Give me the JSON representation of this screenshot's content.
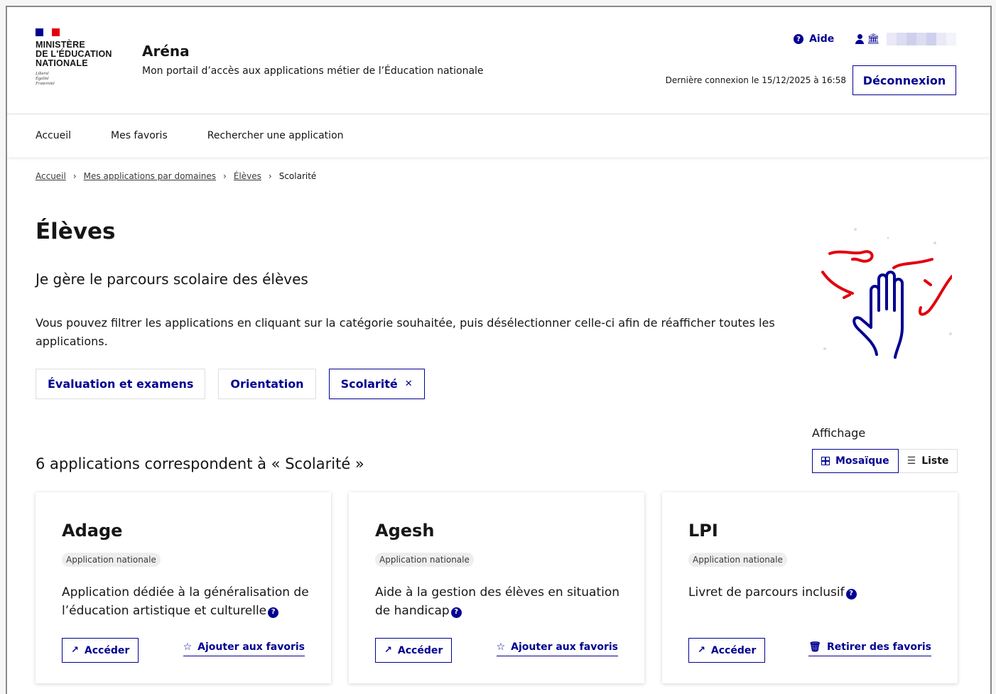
{
  "header": {
    "ministry_lines": [
      "MINISTÈRE",
      "DE L'ÉDUCATION",
      "NATIONALE"
    ],
    "motto_lines": [
      "Liberté",
      "Égalité",
      "Fraternité"
    ],
    "app_name": "Aréna",
    "tagline": "Mon portail d’accès aux applications métier de l’Éducation nationale",
    "help_label": "Aide",
    "help_icon": "question-circle-icon",
    "account_icons": [
      "user-icon",
      "institution-icon"
    ],
    "last_login": "Dernière connexion le 15/12/2025 à 16:58",
    "logout_label": "Déconnexion",
    "colors": {
      "primary": "#000091",
      "flag_red": "#e1000f"
    }
  },
  "nav": {
    "items": [
      "Accueil",
      "Mes favoris",
      "Rechercher une application"
    ]
  },
  "breadcrumb": {
    "links": [
      "Accueil",
      "Mes applications par domaines",
      "Élèves"
    ],
    "current": "Scolarité"
  },
  "page": {
    "title": "Élèves",
    "subtitle": "Je gère le parcours scolaire des élèves",
    "intro": "Vous pouvez filtrer les applications en cliquant sur la catégorie souhaitée, puis désélectionner celle-ci afin de réafficher toutes les applications.",
    "filters": [
      {
        "label": "Évaluation et examens",
        "selected": false
      },
      {
        "label": "Orientation",
        "selected": false
      },
      {
        "label": "Scolarité",
        "selected": true
      }
    ],
    "remove_filter_icon": "close-icon",
    "results_text": "6 applications correspondent à « Scolarité »",
    "display_label": "Affichage",
    "display_options": [
      {
        "label": "Mosaïque",
        "icon": "grid-icon",
        "active": true
      },
      {
        "label": "Liste",
        "icon": "list-icon",
        "active": false
      }
    ]
  },
  "cards": [
    {
      "title": "Adage",
      "badge": "Application nationale",
      "description": "Application dédiée à la généralisation de l’éducation artistique et culturelle",
      "access_label": "Accéder",
      "favorite_label": "Ajouter aux favoris",
      "favorite_icon": "star-icon"
    },
    {
      "title": "Agesh",
      "badge": "Application nationale",
      "description": "Aide à la gestion des élèves en situation de handicap",
      "access_label": "Accéder",
      "favorite_label": "Ajouter aux favoris",
      "favorite_icon": "star-icon"
    },
    {
      "title": "LPI",
      "badge": "Application nationale",
      "description": "Livret de parcours inclusif",
      "access_label": "Accéder",
      "favorite_label": "Retirer des favoris",
      "favorite_icon": "trash-icon"
    }
  ]
}
